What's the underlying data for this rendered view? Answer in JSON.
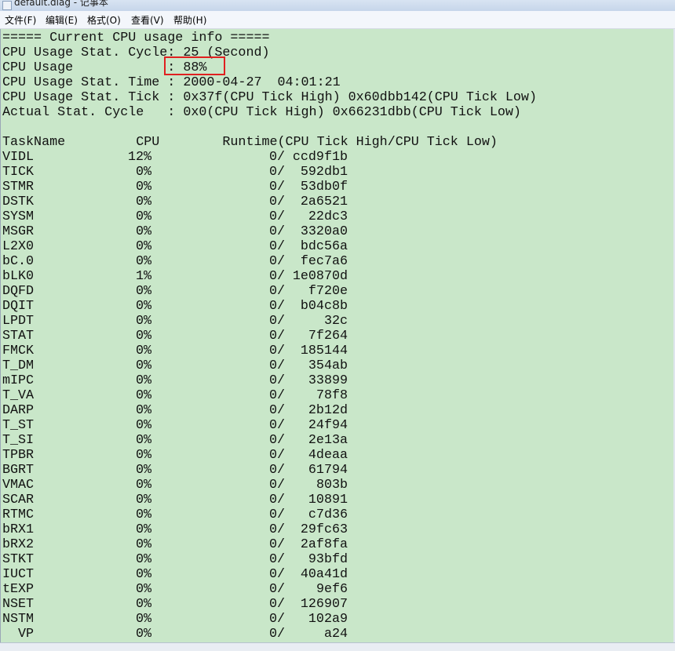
{
  "window": {
    "title": "default.diag - 记事本"
  },
  "menu": [
    "文件(F)",
    "编辑(E)",
    "格式(O)",
    "查看(V)",
    "帮助(H)"
  ],
  "header_lines": [
    "===== Current CPU usage info =====",
    "CPU Usage Stat. Cycle: 25 (Second)",
    "CPU Usage            : 88%",
    "CPU Usage Stat. Time : 2000-04-27  04:01:21",
    "CPU Usage Stat. Tick : 0x37f(CPU Tick High) 0x60dbb142(CPU Tick Low)",
    "Actual Stat. Cycle   : 0x0(CPU Tick High) 0x66231dbb(CPU Tick Low)",
    ""
  ],
  "table_header": "TaskName         CPU        Runtime(CPU Tick High/CPU Tick Low)",
  "tasks": [
    {
      "name": "VIDL",
      "cpu": "12%",
      "high": "0",
      "low": "ccd9f1b"
    },
    {
      "name": "TICK",
      "cpu": "0%",
      "high": "0",
      "low": "592db1"
    },
    {
      "name": "STMR",
      "cpu": "0%",
      "high": "0",
      "low": "53db0f"
    },
    {
      "name": "DSTK",
      "cpu": "0%",
      "high": "0",
      "low": "2a6521"
    },
    {
      "name": "SYSM",
      "cpu": "0%",
      "high": "0",
      "low": "22dc3"
    },
    {
      "name": "MSGR",
      "cpu": "0%",
      "high": "0",
      "low": "3320a0"
    },
    {
      "name": "L2X0",
      "cpu": "0%",
      "high": "0",
      "low": "bdc56a"
    },
    {
      "name": "bC.0",
      "cpu": "0%",
      "high": "0",
      "low": "fec7a6"
    },
    {
      "name": "bLK0",
      "cpu": "1%",
      "high": "0",
      "low": "1e0870d"
    },
    {
      "name": "DQFD",
      "cpu": "0%",
      "high": "0",
      "low": "f720e"
    },
    {
      "name": "DQIT",
      "cpu": "0%",
      "high": "0",
      "low": "b04c8b"
    },
    {
      "name": "LPDT",
      "cpu": "0%",
      "high": "0",
      "low": "32c"
    },
    {
      "name": "STAT",
      "cpu": "0%",
      "high": "0",
      "low": "7f264"
    },
    {
      "name": "FMCK",
      "cpu": "0%",
      "high": "0",
      "low": "185144"
    },
    {
      "name": "T_DM",
      "cpu": "0%",
      "high": "0",
      "low": "354ab"
    },
    {
      "name": "mIPC",
      "cpu": "0%",
      "high": "0",
      "low": "33899"
    },
    {
      "name": "T_VA",
      "cpu": "0%",
      "high": "0",
      "low": "78f8"
    },
    {
      "name": "DARP",
      "cpu": "0%",
      "high": "0",
      "low": "2b12d"
    },
    {
      "name": "T_ST",
      "cpu": "0%",
      "high": "0",
      "low": "24f94"
    },
    {
      "name": "T_SI",
      "cpu": "0%",
      "high": "0",
      "low": "2e13a"
    },
    {
      "name": "TPBR",
      "cpu": "0%",
      "high": "0",
      "low": "4deaa"
    },
    {
      "name": "BGRT",
      "cpu": "0%",
      "high": "0",
      "low": "61794"
    },
    {
      "name": "VMAC",
      "cpu": "0%",
      "high": "0",
      "low": "803b"
    },
    {
      "name": "SCAR",
      "cpu": "0%",
      "high": "0",
      "low": "10891"
    },
    {
      "name": "RTMC",
      "cpu": "0%",
      "high": "0",
      "low": "c7d36"
    },
    {
      "name": "bRX1",
      "cpu": "0%",
      "high": "0",
      "low": "29fc63"
    },
    {
      "name": "bRX2",
      "cpu": "0%",
      "high": "0",
      "low": "2af8fa"
    },
    {
      "name": "STKT",
      "cpu": "0%",
      "high": "0",
      "low": "93bfd"
    },
    {
      "name": "IUCT",
      "cpu": "0%",
      "high": "0",
      "low": "40a41d"
    },
    {
      "name": "tEXP",
      "cpu": "0%",
      "high": "0",
      "low": "9ef6"
    },
    {
      "name": "NSET",
      "cpu": "0%",
      "high": "0",
      "low": "126907"
    },
    {
      "name": "NSTM",
      "cpu": "0%",
      "high": "0",
      "low": "102a9"
    },
    {
      "name": "  VP",
      "cpu": "0%",
      "high": "0",
      "low": "a24"
    }
  ],
  "colors": {
    "editor_background": "#c9e7c9",
    "highlight_border": "#e02020",
    "text": "#111111"
  }
}
